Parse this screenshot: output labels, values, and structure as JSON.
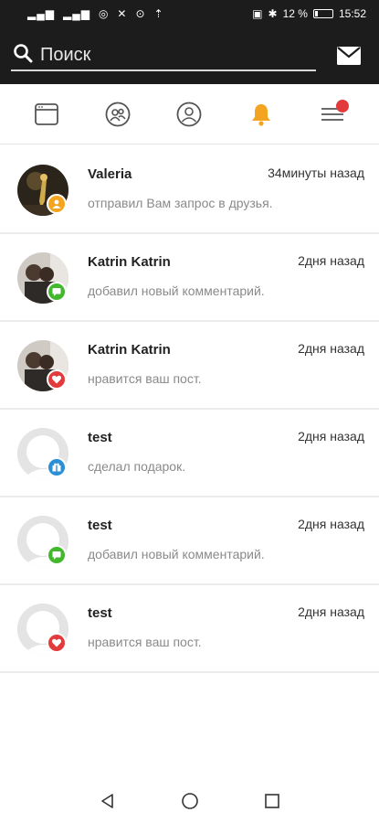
{
  "status_bar": {
    "signal": "",
    "battery_percent": "12 %",
    "time": "15:52"
  },
  "search": {
    "placeholder": "Поиск",
    "value": ""
  },
  "tabs": [
    {
      "icon": "news-feed-icon"
    },
    {
      "icon": "friends-icon"
    },
    {
      "icon": "profile-icon"
    },
    {
      "icon": "bell-icon",
      "active": true
    },
    {
      "icon": "menu-icon",
      "badge": true
    }
  ],
  "notifications": [
    {
      "name": "Valeria",
      "time": "34минуты назад",
      "message": "отправил Вам запрос в друзья.",
      "badge": "friend-request-icon",
      "badge_color": "#f3a521"
    },
    {
      "name": "Katrin Katrin",
      "time": "2дня назад",
      "message": "добавил новый комментарий.",
      "badge": "comment-icon",
      "badge_color": "#43b82f"
    },
    {
      "name": "Katrin Katrin",
      "time": "2дня назад",
      "message": "нравится ваш пост.",
      "badge": "heart-icon",
      "badge_color": "#e33b3b"
    },
    {
      "name": "test",
      "time": "2дня назад",
      "message": "сделал подарок.",
      "badge": "gift-icon",
      "badge_color": "#2b8fd6"
    },
    {
      "name": "test",
      "time": "2дня назад",
      "message": "добавил новый комментарий.",
      "badge": "comment-icon",
      "badge_color": "#43b82f"
    },
    {
      "name": "test",
      "time": "2дня назад",
      "message": "нравится ваш пост.",
      "badge": "heart-icon",
      "badge_color": "#e33b3b"
    }
  ],
  "colors": {
    "header_bg": "#1c1c1c",
    "accent_bell": "#f3a521",
    "menu_badge": "#e33b3b"
  }
}
